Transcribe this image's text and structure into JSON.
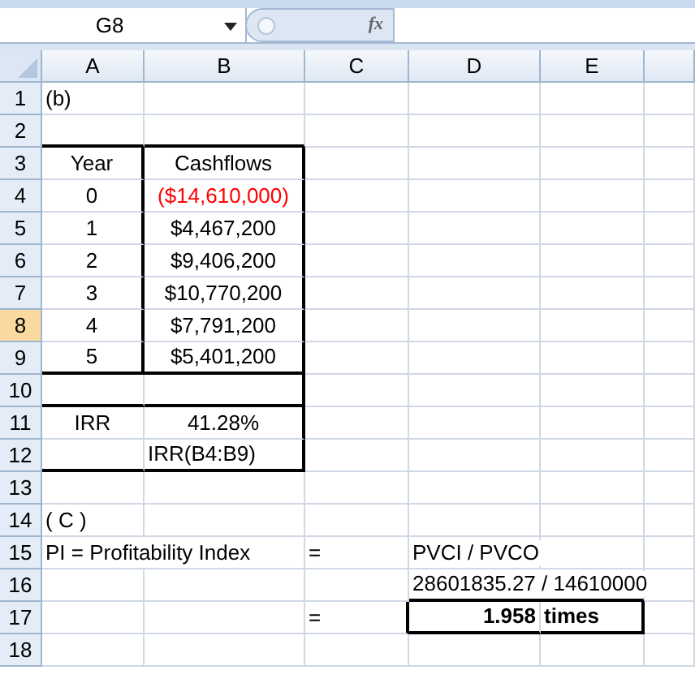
{
  "name_box": {
    "value": "G8"
  },
  "formula_bar": {
    "fx": "fx"
  },
  "columns": [
    {
      "label": "A",
      "selected": false
    },
    {
      "label": "B",
      "selected": false
    },
    {
      "label": "C",
      "selected": false
    },
    {
      "label": "D",
      "selected": false
    },
    {
      "label": "E",
      "selected": false
    }
  ],
  "rows": [
    {
      "label": "1",
      "selected": false,
      "cells": {
        "A": {
          "text": "(b)"
        }
      }
    },
    {
      "label": "2",
      "selected": false,
      "cells": {}
    },
    {
      "label": "3",
      "selected": false,
      "cells": {
        "A": {
          "text": "Year"
        },
        "B": {
          "text": "Cashflows"
        }
      }
    },
    {
      "label": "4",
      "selected": false,
      "cells": {
        "A": {
          "text": "0"
        },
        "B": {
          "text": "($14,610,000)",
          "color": "#ff0000"
        }
      }
    },
    {
      "label": "5",
      "selected": false,
      "cells": {
        "A": {
          "text": "1"
        },
        "B": {
          "text": "$4,467,200"
        }
      }
    },
    {
      "label": "6",
      "selected": false,
      "cells": {
        "A": {
          "text": "2"
        },
        "B": {
          "text": "$9,406,200"
        }
      }
    },
    {
      "label": "7",
      "selected": false,
      "cells": {
        "A": {
          "text": "3"
        },
        "B": {
          "text": "$10,770,200"
        }
      }
    },
    {
      "label": "8",
      "selected": true,
      "cells": {
        "A": {
          "text": "4"
        },
        "B": {
          "text": "$7,791,200"
        }
      }
    },
    {
      "label": "9",
      "selected": false,
      "cells": {
        "A": {
          "text": "5"
        },
        "B": {
          "text": "$5,401,200"
        }
      }
    },
    {
      "label": "10",
      "selected": false,
      "cells": {}
    },
    {
      "label": "11",
      "selected": false,
      "cells": {
        "A": {
          "text": "IRR"
        },
        "B": {
          "text": "41.28%"
        }
      }
    },
    {
      "label": "12",
      "selected": false,
      "cells": {
        "B": {
          "text": "IRR(B4:B9)"
        }
      }
    },
    {
      "label": "13",
      "selected": false,
      "cells": {}
    },
    {
      "label": "14",
      "selected": false,
      "cells": {
        "A": {
          "text": "(  C  )"
        }
      }
    },
    {
      "label": "15",
      "selected": false,
      "cells": {
        "A": {
          "text": "PI = Profitability Index"
        },
        "C": {
          "text": "="
        },
        "D": {
          "text": "PVCI / PVCO"
        }
      }
    },
    {
      "label": "16",
      "selected": false,
      "cells": {
        "D": {
          "text": "28601835.27 / 14610000"
        }
      }
    },
    {
      "label": "17",
      "selected": false,
      "cells": {
        "C": {
          "text": "="
        },
        "D": {
          "text": "1.958",
          "bold": true
        },
        "E": {
          "text": "times",
          "bold": true
        }
      }
    },
    {
      "label": "18",
      "selected": false,
      "cells": {}
    }
  ]
}
